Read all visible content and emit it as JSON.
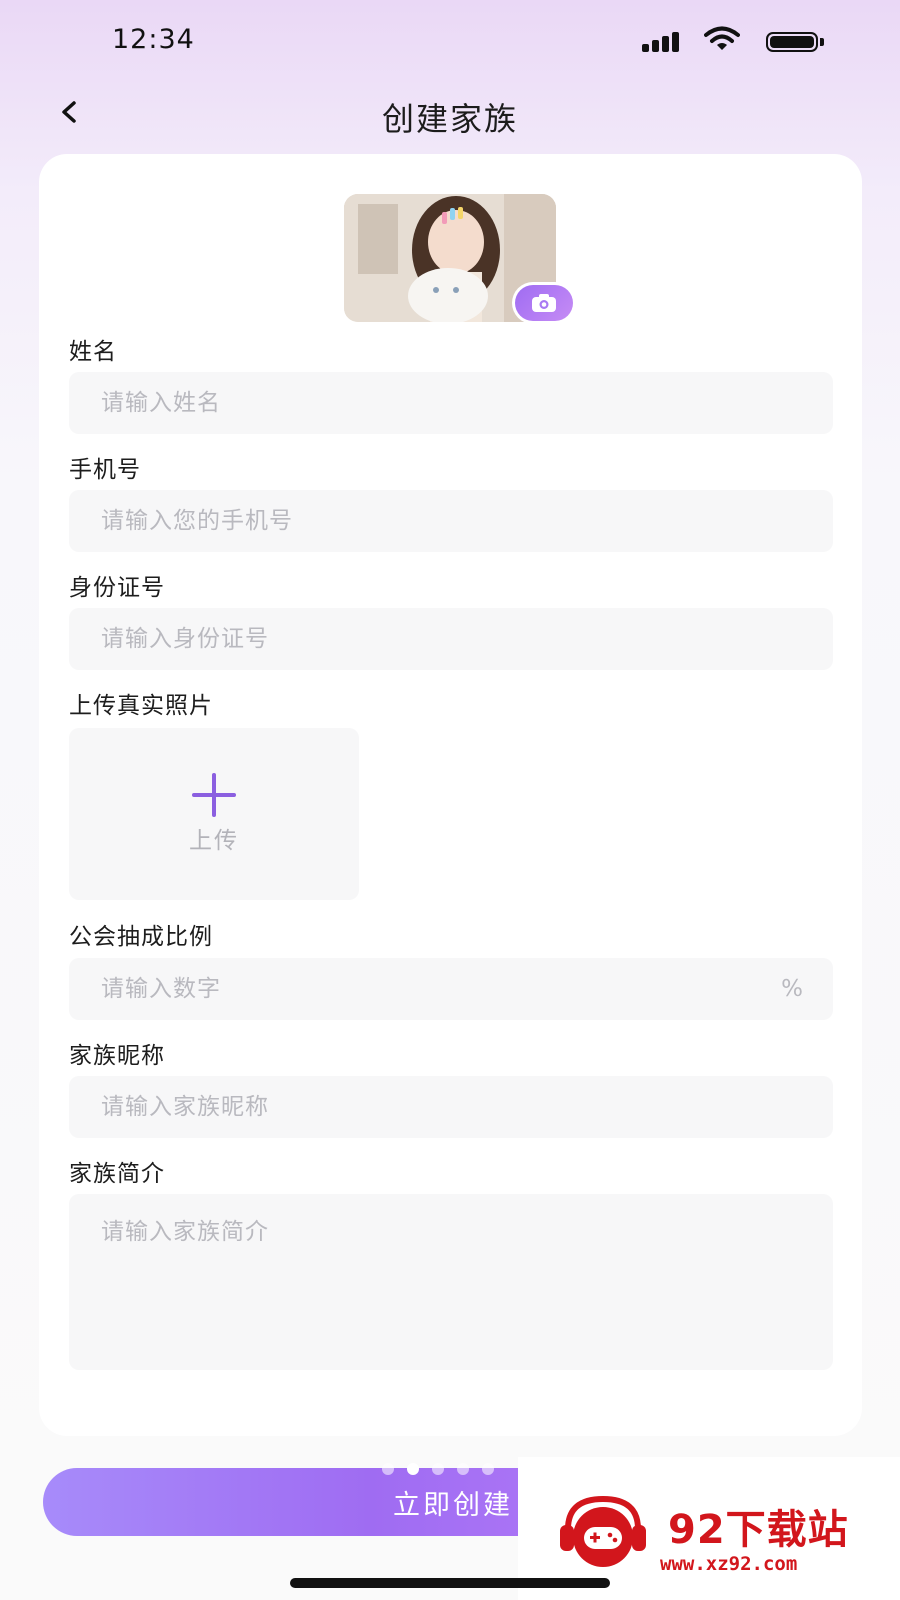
{
  "status_bar": {
    "time": "12:34"
  },
  "header": {
    "title": "创建家族"
  },
  "form": {
    "name": {
      "label": "姓名",
      "placeholder": "请输入姓名"
    },
    "phone": {
      "label": "手机号",
      "placeholder": "请输入您的手机号"
    },
    "id_number": {
      "label": "身份证号",
      "placeholder": "请输入身份证号"
    },
    "photo": {
      "label": "上传真实照片",
      "upload_text": "上传"
    },
    "commission": {
      "label": "公会抽成比例",
      "placeholder": "请输入数字",
      "suffix": "%"
    },
    "nickname": {
      "label": "家族昵称",
      "placeholder": "请输入家族昵称"
    },
    "intro": {
      "label": "家族简介",
      "placeholder": "请输入家族简介"
    }
  },
  "submit": {
    "label": "立即创建"
  },
  "watermark": {
    "title": "92下载站",
    "url": "www.xz92.com"
  },
  "colors": {
    "accent": "#9f6cf2",
    "accent_light": "#c084fc",
    "field_bg": "#f7f7f8",
    "watermark_red": "#d2161c"
  },
  "icons": {
    "back": "chevron-left-icon",
    "camera": "camera-icon",
    "upload": "plus-icon"
  }
}
